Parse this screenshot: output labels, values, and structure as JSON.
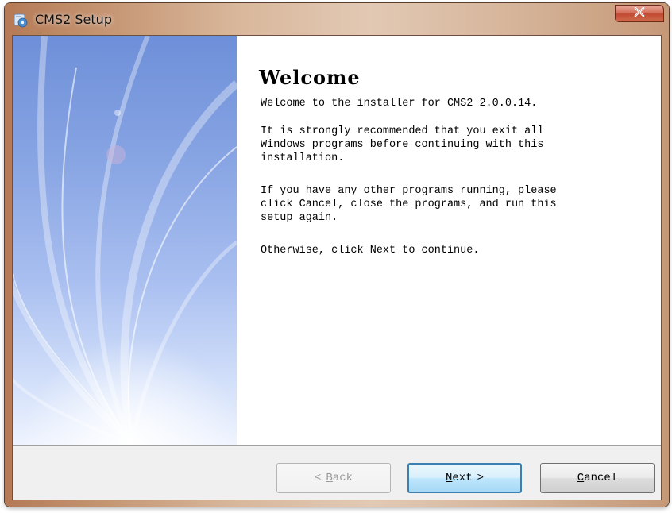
{
  "window": {
    "title": "CMS2 Setup",
    "close_glyph": "x",
    "icon": "installer-disc-icon"
  },
  "wizard": {
    "heading": "Welcome",
    "intro": "Welcome to the installer for CMS2 2.0.0.14.",
    "paragraphs": [
      "It is strongly recommended that you exit all\nWindows programs before continuing with this\ninstallation.",
      "If you have any other programs running, please\nclick Cancel, close the programs, and run this\nsetup again.",
      "Otherwise, click Next to continue."
    ]
  },
  "buttons": {
    "back": {
      "prefix": "<",
      "label": "Back",
      "enabled": false
    },
    "next": {
      "label": "Next",
      "suffix": ">",
      "default": true
    },
    "cancel": {
      "label": "Cancel"
    }
  },
  "colors": {
    "next_border": "#3c7fb1",
    "side_panel_top": "#6e8fd9",
    "side_panel_bottom": "#eef3fe"
  }
}
